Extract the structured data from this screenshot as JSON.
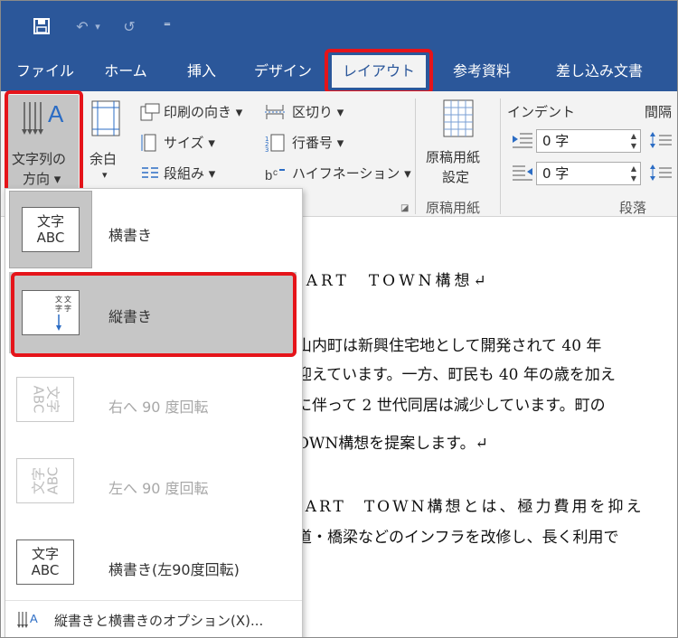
{
  "quick_access": {
    "save": "save-icon",
    "undo": "↶",
    "undo_arrow": "▾",
    "redo": "↺",
    "customize": "⁼"
  },
  "tabs": [
    {
      "label": "ファイル"
    },
    {
      "label": "ホーム"
    },
    {
      "label": "挿入"
    },
    {
      "label": "デザイン"
    },
    {
      "label": "レイアウト"
    },
    {
      "label": "参考資料"
    },
    {
      "label": "差し込み文書"
    }
  ],
  "ribbon": {
    "text_direction": {
      "label1": "文字列の",
      "label2": "方向 ▾"
    },
    "margins": {
      "label": "余白",
      "arrow": "▾"
    },
    "orientation": "印刷の向き ▾",
    "size": "サイズ ▾",
    "columns": "段組み ▾",
    "breaks": "区切り ▾",
    "line_numbers": "行番号 ▾",
    "hyphenation": "ハイフネーション ▾",
    "manuscript": {
      "label1": "原稿用紙",
      "label2": "設定",
      "group": "原稿用紙"
    },
    "indent": {
      "title": "インデント",
      "left_value": "0 字",
      "right_value": "0 字"
    },
    "spacing_title": "間隔",
    "paragraph_group": "段落"
  },
  "document": {
    "lines": [
      "IART　TOWN構想↵",
      "山内町は新興住宅地として開発されて 40 年",
      "迎えています。一方、町民も 40 年の歳を加え",
      "に伴って 2 世代同居は減少しています。町の",
      "OWN構想を提案します。↵",
      "IART　TOWN構想とは、極力費用を抑え",
      "道・橋梁などのインフラを改修し、長く利用で"
    ]
  },
  "menu": {
    "items": [
      {
        "icon_top": "文字",
        "icon_bottom": "ABC",
        "label": "横書き"
      },
      {
        "icon_top": "文字",
        "icon_bottom": "ABC",
        "label": "縦書き"
      },
      {
        "icon_top": "文字",
        "icon_bottom": "ABC",
        "label": "右へ 90 度回転"
      },
      {
        "icon_top": "文字",
        "icon_bottom": "ABC",
        "label": "左へ 90 度回転"
      },
      {
        "icon_top": "文字",
        "icon_bottom": "ABC",
        "label": "横書き(左90度回転)"
      }
    ],
    "options_label": "縦書きと横書きのオプション(X)..."
  },
  "colors": {
    "accent": "#2b579a",
    "highlight": "#e5141a",
    "selected": "#c6c6c6"
  }
}
